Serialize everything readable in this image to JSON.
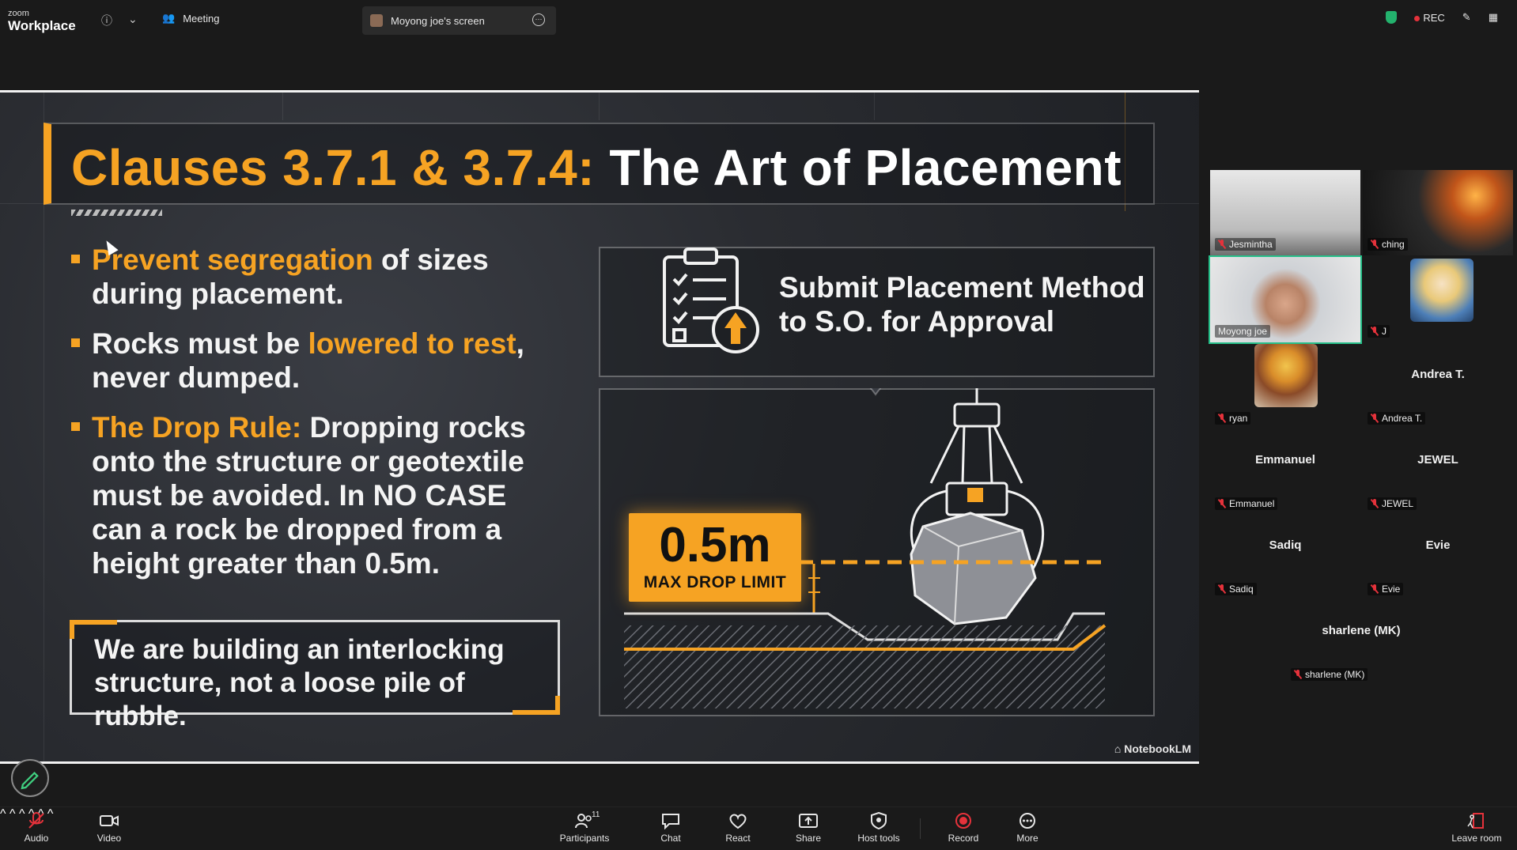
{
  "app": {
    "brand_small": "zoom",
    "brand_big": "Workplace",
    "meeting_tab": "Meeting",
    "screen_tab": "Moyong joe's screen",
    "rec_label": "REC"
  },
  "slide": {
    "title_highlight": "Clauses 3.7.1 & 3.7.4:",
    "title_rest": "The Art of Placement",
    "bullets": [
      {
        "hl": "Prevent segregation",
        "rest": " of sizes during placement."
      },
      {
        "pre": "Rocks must be ",
        "hl": "lowered to rest",
        "rest": ", never dumped."
      },
      {
        "hl": "The Drop Rule:",
        "rest": " Dropping rocks onto the structure or geotextile must be avoided. In NO CASE can a rock be dropped from a height greater than 0.5m."
      }
    ],
    "callout": "We are building an interlocking structure, not a loose pile of rubble.",
    "submit_line1": "Submit Placement Method",
    "submit_line2": "to S.O. for Approval",
    "drop_value": "0.5m",
    "drop_label": "MAX DROP LIMIT",
    "watermark": "NotebookLM",
    "accent_color": "#f6a323"
  },
  "gallery": {
    "participants": [
      {
        "name": "Jesmintha",
        "video": true
      },
      {
        "name": "ching",
        "video": true
      },
      {
        "name": "Moyong joe",
        "video": true,
        "active": true
      },
      {
        "name": "J",
        "avatar": true
      },
      {
        "name": "ryan",
        "avatar": true
      },
      {
        "name": "Andrea T.",
        "center": "Andrea T."
      },
      {
        "name": "Emmanuel",
        "center": "Emmanuel"
      },
      {
        "name": "JEWEL",
        "center": "JEWEL"
      },
      {
        "name": "Sadiq",
        "center": "Sadiq"
      },
      {
        "name": "Evie",
        "center": "Evie"
      },
      {
        "name": "sharlene (MK)",
        "center": "sharlene (MK)"
      }
    ]
  },
  "toolbar": {
    "audio": "Audio",
    "video": "Video",
    "participants": "Participants",
    "participants_count": "11",
    "chat": "Chat",
    "react": "React",
    "share": "Share",
    "host_tools": "Host tools",
    "record": "Record",
    "more": "More",
    "leave": "Leave room"
  }
}
